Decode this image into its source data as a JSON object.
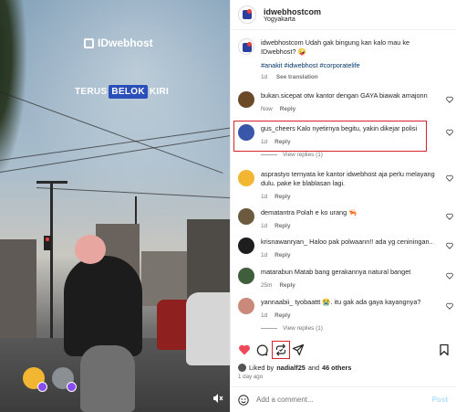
{
  "video": {
    "brand": "IDwebhost",
    "caption_pre": "TERUS",
    "caption_hl": "BELOK",
    "caption_post": "KIRI"
  },
  "post": {
    "username": "idwebhostcom",
    "location": "Yogyakarta",
    "caption_user": "idwebhostcom",
    "caption_text": "Udah gak bingung kan kalo mau ke IDwebhost? 🤪",
    "hashtags": "#anakit #idwebhost #corporatelife",
    "caption_age": "1d",
    "see_translation": "See translation"
  },
  "comments": [
    {
      "user": "bukan.sicepat",
      "text": "otw kantor dengan GAYA biawak amajonn",
      "age": "Now",
      "reply": "Reply",
      "avatar_color": "#6b4a2a"
    },
    {
      "user": "gus_cheers",
      "text": "Kalo nyetirnya begitu, yakin dikejar polisi",
      "age": "1d",
      "reply": "Reply",
      "avatar_color": "#3a56a8",
      "view_replies": "View replies (1)"
    },
    {
      "user": "asprastyo",
      "text": "ternyata ke kantor idwebhost aja perlu melayang dulu. pake ke blablasan lagi.",
      "age": "1d",
      "reply": "Reply",
      "avatar_color": "#f2b632"
    },
    {
      "user": "dematantra",
      "text": "Polah e ko urang 🦐",
      "age": "1d",
      "reply": "Reply",
      "avatar_color": "#6b5a3d"
    },
    {
      "user": "krisnawanryan_",
      "text": "Haloo pak polwaann!! ada yg ceniningan..",
      "age": "1d",
      "reply": "Reply",
      "avatar_color": "#1e1e1e"
    },
    {
      "user": "matarabun",
      "text": "Matab bang gerakannya natural banget",
      "age": "25m",
      "reply": "Reply",
      "avatar_color": "#3f5e3a"
    },
    {
      "user": "yannaabii_",
      "text": "tyobaattt 😭. itu gak ada gaya kayangnya?",
      "age": "1d",
      "reply": "Reply",
      "avatar_color": "#c98a7a",
      "view_replies": "View replies (1)"
    }
  ],
  "likes": {
    "prefix": "Liked by",
    "user": "nadialf25",
    "mid": "and",
    "others": "46 others",
    "age": "1 day ago"
  },
  "add_comment": {
    "placeholder": "Add a comment...",
    "post": "Post"
  },
  "colors": {
    "accent_red": "#d9222a",
    "heart_red": "#ed4956",
    "link_blue": "#00376b"
  },
  "icons": [
    "heart-icon",
    "comment-icon",
    "repost-icon",
    "share-icon",
    "bookmark-icon",
    "smile-icon",
    "mute-icon"
  ]
}
